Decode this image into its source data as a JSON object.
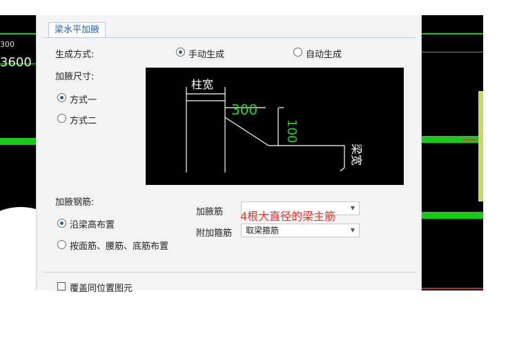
{
  "cad_left": {
    "text_top": "300",
    "text_main": "3600"
  },
  "dialog": {
    "tab": "梁水平加腋",
    "mode_label": "生成方式:",
    "mode_options": [
      "手动生成",
      "自动生成"
    ],
    "mode_selected": "手动生成",
    "size_label": "加腋尺寸:",
    "size_options": [
      "方式一",
      "方式二"
    ],
    "size_selected": "方式一",
    "rebar_label": "加腋钢筋:",
    "layout_options": [
      "沿梁高布置",
      "按面筋、腰筋、底筋布置"
    ],
    "layout_selected": "沿梁高布置",
    "haunch_bar_label": "加腋筋",
    "haunch_bar_value": "",
    "stirrup_label": "附加箍筋",
    "stirrup_value": "取梁箍筋",
    "overwrite_label": "覆盖同位置图元"
  },
  "diagram": {
    "column_width": "柱宽",
    "length_value": "300",
    "depth_value": "100",
    "beam_width": "梁宽"
  },
  "annotation": "4根大直径的梁主筋"
}
